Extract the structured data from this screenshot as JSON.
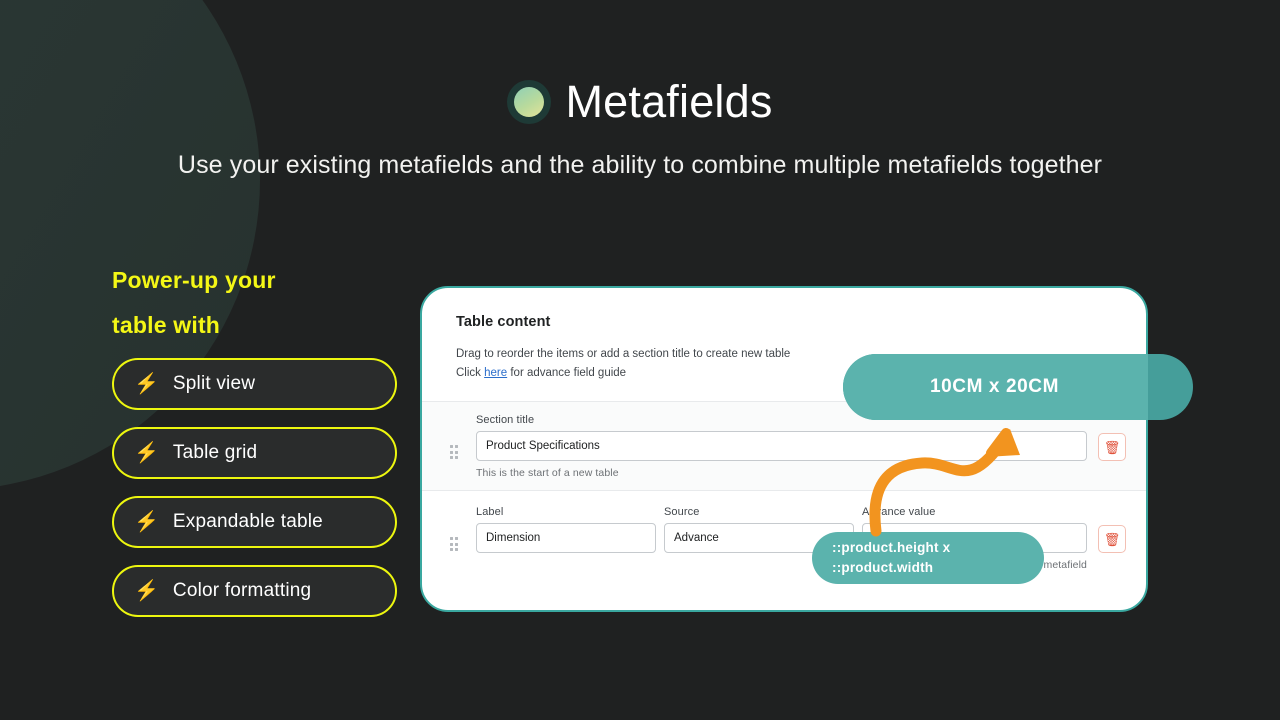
{
  "header": {
    "logo_icon": "metafields-circle-logo",
    "title": "Metafields",
    "subtitle": "Use your existing metafields and the ability to combine\nmultiple metafields together"
  },
  "features": {
    "heading": "Power-up your\ntable with",
    "bolt_icon": "lightning-bolt-icon",
    "items": [
      {
        "label": "Split view"
      },
      {
        "label": "Table grid"
      },
      {
        "label": "Expandable table"
      },
      {
        "label": "Color formatting"
      }
    ]
  },
  "card": {
    "title": "Table content",
    "description_line1": "Drag to reorder the items or add a section title to create new table",
    "description_line2_pre": "Click ",
    "description_link": "here",
    "description_line2_post": " for advance field guide",
    "section_row": {
      "drag_icon": "drag-handle-icon",
      "label": "Section title",
      "value": "Product Specifications",
      "help": "This is the start of a new table",
      "delete_icon": "trash-icon"
    },
    "item_row": {
      "drag_icon": "drag-handle-icon",
      "label_field": {
        "label": "Label",
        "value": "Dimension"
      },
      "source_field": {
        "label": "Source",
        "value": "Advance"
      },
      "advance_field": {
        "label": "Advance value",
        "value": "",
        "help": "Add :: in front of your custom metafield"
      },
      "delete_icon": "trash-icon"
    }
  },
  "annotations": {
    "dimension_badge": "10CM x 20CM",
    "advance_badge_line1": "::product.height x",
    "advance_badge_line2": "::product.width",
    "arrow_icon": "curved-arrow-icon"
  },
  "colors": {
    "background": "#1f2121",
    "accent_yellow": "#edf70f",
    "accent_teal": "#5bb3ad",
    "card_border_teal": "#3aa8a0",
    "arrow_orange": "#f2941f",
    "link_blue": "#2c6ecb",
    "trash_red": "#e0513a"
  }
}
